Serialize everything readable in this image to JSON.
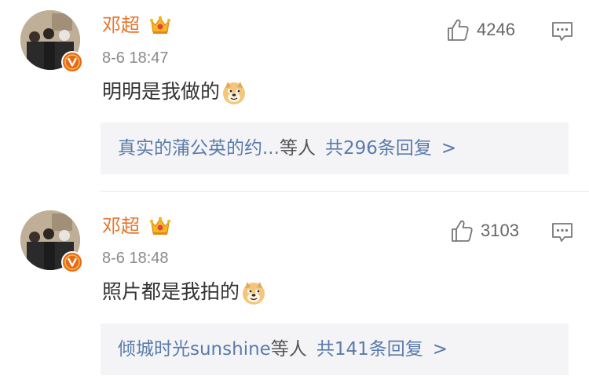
{
  "comments": [
    {
      "username": "邓超",
      "time": "8-6 18:47",
      "text": "明明是我做的",
      "likes": "4246",
      "reply_names": "真实的蒲公英的约...",
      "reply_suffix": "等人",
      "reply_total": "共296条回复",
      "chevron": ">",
      "icons": [
        "avatar",
        "verified-v-icon",
        "crown-badge-icon",
        "doge-emoji-icon",
        "thumbs-up-icon",
        "reply-icon"
      ]
    },
    {
      "username": "邓超",
      "time": "8-6 18:48",
      "text": "照片都是我拍的",
      "likes": "3103",
      "reply_names": "倾城时光sunshine",
      "reply_suffix": "等人",
      "reply_total": "共141条回复",
      "chevron": ">",
      "icons": [
        "avatar",
        "verified-v-icon",
        "crown-badge-icon",
        "doge-emoji-icon",
        "thumbs-up-icon",
        "reply-icon"
      ]
    }
  ],
  "colors": {
    "username": "#e5762b",
    "link": "#5a7bab",
    "reply_bg": "#f4f4f6",
    "verified_badge": "#e86a1a"
  }
}
